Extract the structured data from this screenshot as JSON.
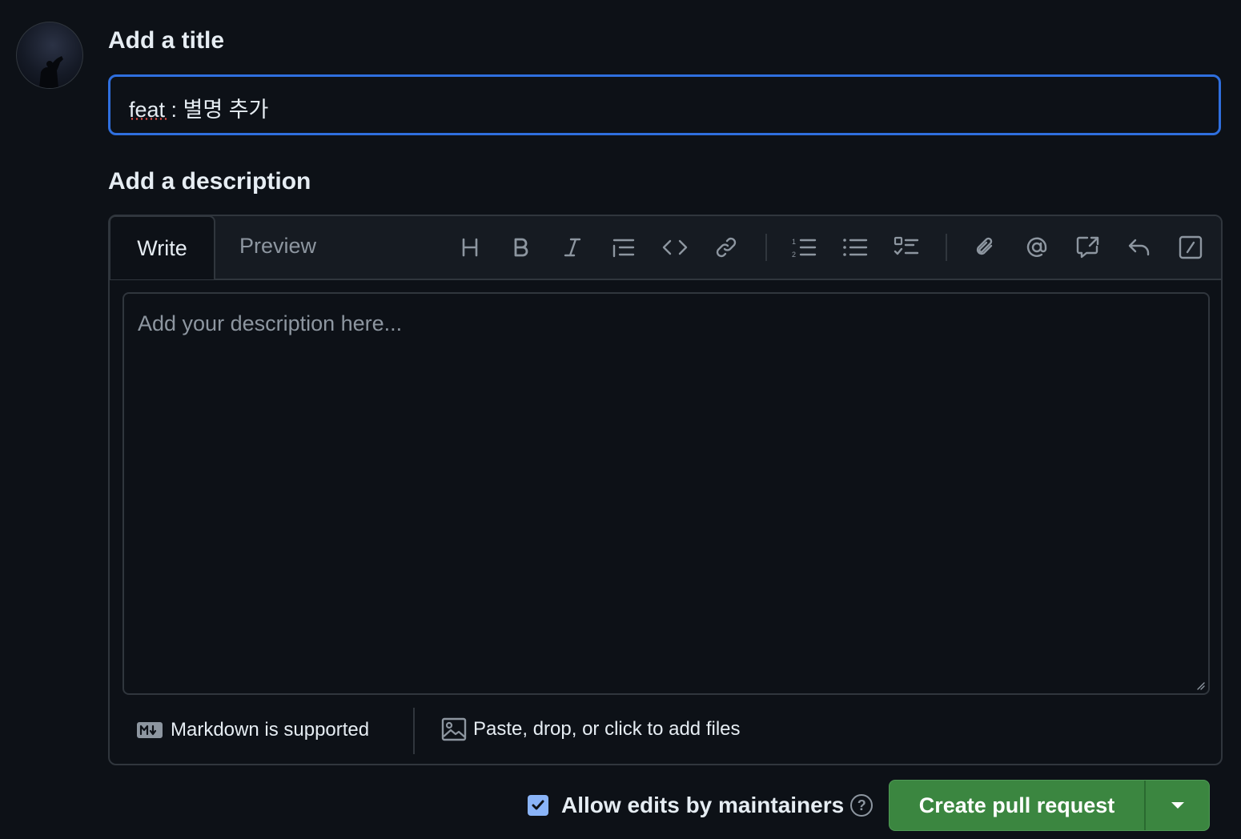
{
  "title_section": {
    "heading": "Add a title",
    "value": "feat : 별명 추가"
  },
  "description_section": {
    "heading": "Add a description",
    "tabs": [
      "Write",
      "Preview"
    ],
    "active_tab": "Write",
    "toolbar": [
      "heading-icon",
      "bold-icon",
      "italic-icon",
      "quote-icon",
      "code-icon",
      "link-icon",
      "numbered-list-icon",
      "unordered-list-icon",
      "task-list-icon",
      "attach-icon",
      "mention-icon",
      "reference-icon",
      "reply-icon",
      "slash-command-icon"
    ],
    "placeholder": "Add your description here...",
    "markdown_note": "Markdown is supported",
    "files_note": "Paste, drop, or click to add files"
  },
  "actions": {
    "allow_edits_label": "Allow edits by maintainers",
    "allow_edits_checked": true,
    "help_glyph": "?",
    "submit_label": "Create pull request"
  },
  "colors": {
    "background": "#0d1117",
    "focus_border": "#2f6fde",
    "submit_green": "#3b8640",
    "checkbox": "#8ab4f8"
  }
}
